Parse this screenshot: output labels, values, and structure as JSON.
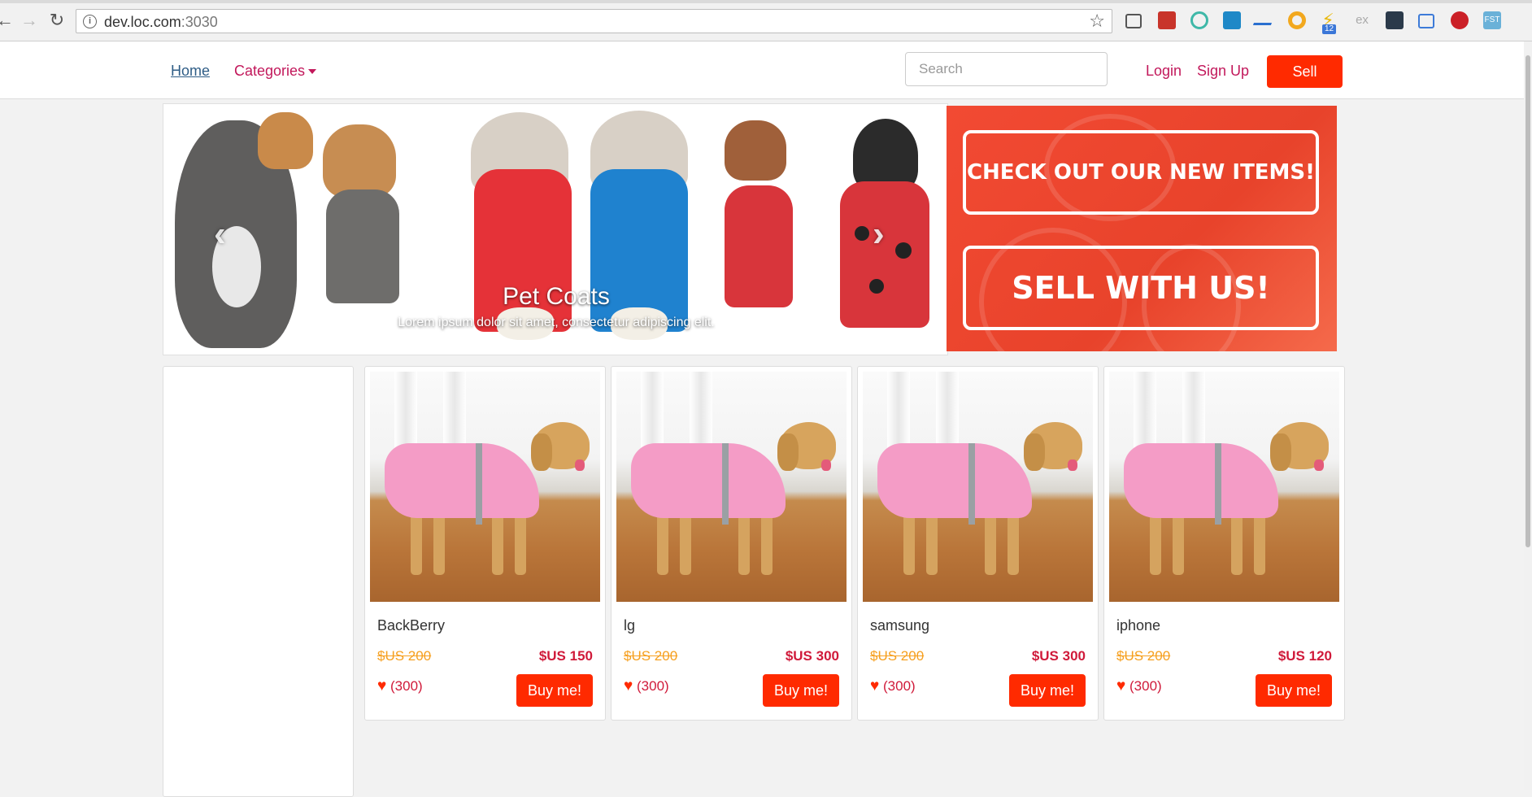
{
  "browser": {
    "url_host": "dev.loc.com",
    "url_port": ":3030",
    "extension_badge": "12",
    "extension_label_ex": "ex",
    "extension_label_fst": "FST",
    "icons": [
      "back-icon",
      "forward-icon",
      "reload-icon",
      "info-icon",
      "bookmark-star-icon"
    ]
  },
  "header": {
    "home_label": "Home",
    "categories_label": "Categories",
    "search_placeholder": "Search",
    "login_label": "Login",
    "signup_label": "Sign Up",
    "sell_label": "Sell"
  },
  "carousel": {
    "caption_title": "Pet Coats",
    "caption_text": "Lorem ipsum dolor sit amet, consectetur adipiscing elit.",
    "prev_icon": "‹",
    "next_icon": "›"
  },
  "promo": {
    "line1": "CHECK OUT OUR NEW ITEMS!",
    "line2": "SELL WITH US!"
  },
  "products": [
    {
      "name": "BackBerry",
      "old_price": "$US 200",
      "price": "$US 150",
      "likes": "(300)",
      "buy_label": "Buy me!"
    },
    {
      "name": "lg",
      "old_price": "$US 200",
      "price": "$US 300",
      "likes": "(300)",
      "buy_label": "Buy me!"
    },
    {
      "name": "samsung",
      "old_price": "$US 200",
      "price": "$US 300",
      "likes": "(300)",
      "buy_label": "Buy me!"
    },
    {
      "name": "iphone",
      "old_price": "$US 200",
      "price": "$US 120",
      "likes": "(300)",
      "buy_label": "Buy me!"
    }
  ],
  "colors": {
    "accent": "#ff2a00",
    "link": "#c2185b",
    "old_price": "#f6a020",
    "price": "#d01a3a"
  }
}
